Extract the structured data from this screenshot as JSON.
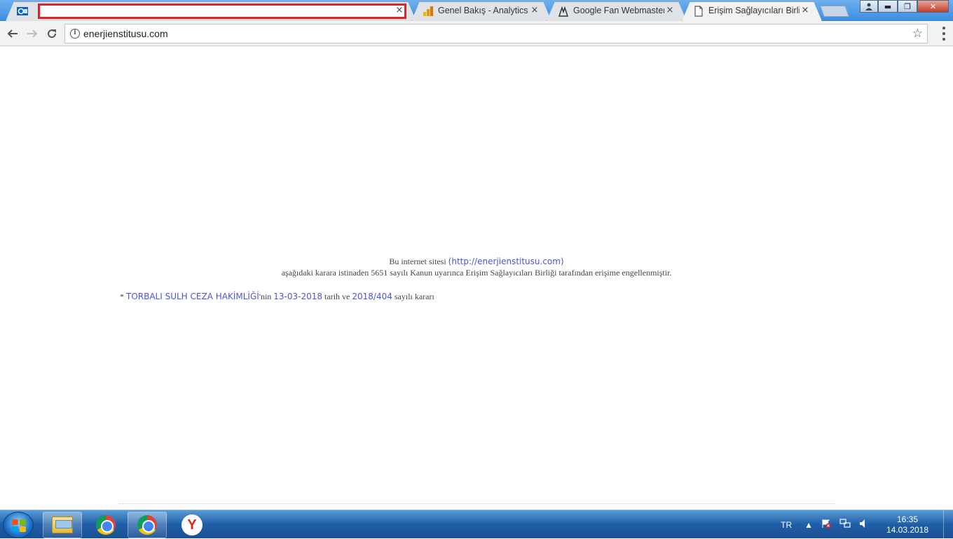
{
  "browser": {
    "tabs": [
      {
        "title": "",
        "close": "×",
        "favicon": "outlook-icon",
        "redacted": true
      },
      {
        "title": "Genel Bakış - Analytics",
        "close": "×",
        "favicon": "analytics-icon"
      },
      {
        "title": "Google Fan Webmaster F",
        "close": "×",
        "favicon": "webmaster-icon"
      },
      {
        "title": "Erişim Sağlayıcıları Birliği",
        "close": "×",
        "favicon": "page-icon",
        "active": true
      }
    ],
    "address": {
      "url": "enerjienstitusu.com"
    },
    "window_buttons": {
      "minimize": "▬",
      "maximize": "❐",
      "close": "✕"
    }
  },
  "page": {
    "line1_prefix": "Bu internet sitesi",
    "line1_link": "(http://enerjienstitusu.com)",
    "line2": "aşağıdaki karara istinaden 5651 sayılı Kanun uyarınca Erişim Sağlayıcıları Birliği tarafından erişime engellenmiştir.",
    "decision": {
      "bullet": "*",
      "court": "TORBALI SULH CEZA HAKİMLİĞİ",
      "court_suffix": "'nin",
      "date": "13-03-2018",
      "date_suffix": "tarih ve",
      "number": "2018/404",
      "number_suffix": "sayılı kararı"
    }
  },
  "taskbar": {
    "apps": [
      "windows-explorer-icon",
      "chrome-icon",
      "chrome-icon",
      "yandex-icon"
    ],
    "yandex_letter": "Y",
    "tray": {
      "language": "TR",
      "time": "16:35",
      "date": "14.03.2018"
    }
  },
  "colors": {
    "link": "#4a54d8",
    "redaction_border": "#e0202a"
  }
}
